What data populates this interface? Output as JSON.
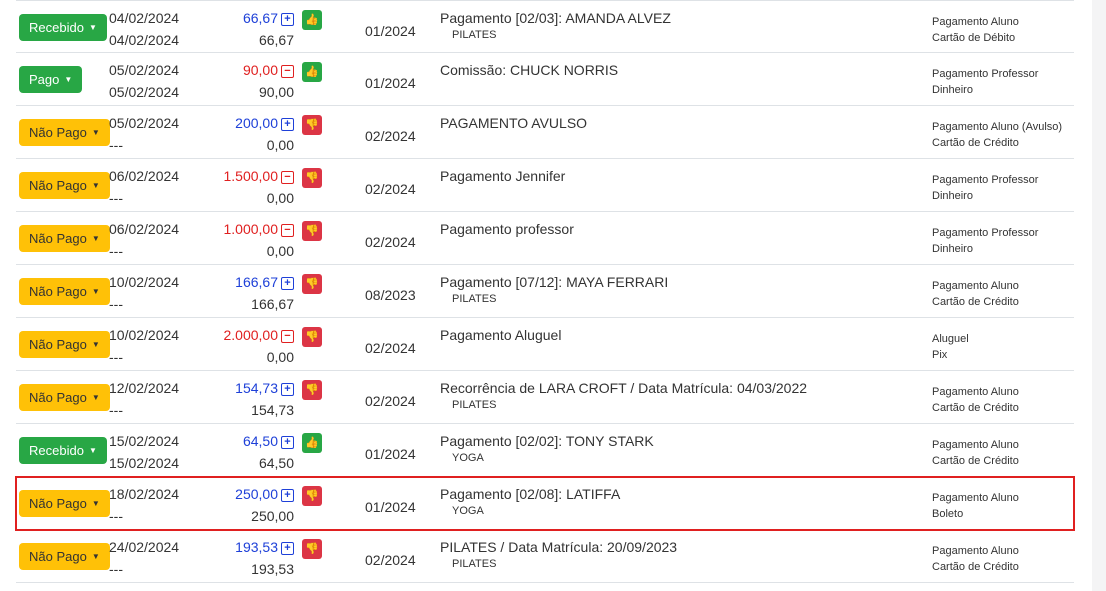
{
  "rows": [
    {
      "status": "Recebido",
      "status_color": "green",
      "date1": "04/02/2024",
      "date2": "04/02/2024",
      "amount": "66,67",
      "amount_color": "blue",
      "sign": "+",
      "paid": "66,67",
      "thumb": "up",
      "period": "01/2024",
      "desc": "Pagamento [02/03]: AMANDA ALVEZ",
      "sub": "PILATES",
      "cat1": "Pagamento Aluno",
      "cat2": "Cartão de Débito"
    },
    {
      "status": "Pago",
      "status_color": "green",
      "date1": "05/02/2024",
      "date2": "05/02/2024",
      "amount": "90,00",
      "amount_color": "red",
      "sign": "−",
      "paid": "90,00",
      "thumb": "up",
      "period": "01/2024",
      "desc": "Comissão: CHUCK NORRIS",
      "sub": "",
      "cat1": "Pagamento Professor",
      "cat2": "Dinheiro"
    },
    {
      "status": "Não Pago",
      "status_color": "yellow",
      "date1": "05/02/2024",
      "date2": "---",
      "amount": "200,00",
      "amount_color": "blue",
      "sign": "+",
      "paid": "0,00",
      "thumb": "down",
      "period": "02/2024",
      "desc": "PAGAMENTO AVULSO",
      "sub": "",
      "cat1": "Pagamento Aluno (Avulso)",
      "cat2": "Cartão de Crédito"
    },
    {
      "status": "Não Pago",
      "status_color": "yellow",
      "date1": "06/02/2024",
      "date2": "---",
      "amount": "1.500,00",
      "amount_color": "red",
      "sign": "−",
      "paid": "0,00",
      "thumb": "down",
      "period": "02/2024",
      "desc": "Pagamento Jennifer",
      "sub": "",
      "cat1": "Pagamento Professor",
      "cat2": "Dinheiro"
    },
    {
      "status": "Não Pago",
      "status_color": "yellow",
      "date1": "06/02/2024",
      "date2": "---",
      "amount": "1.000,00",
      "amount_color": "red",
      "sign": "−",
      "paid": "0,00",
      "thumb": "down",
      "period": "02/2024",
      "desc": "Pagamento professor",
      "sub": "",
      "cat1": "Pagamento Professor",
      "cat2": "Dinheiro"
    },
    {
      "status": "Não Pago",
      "status_color": "yellow",
      "date1": "10/02/2024",
      "date2": "---",
      "amount": "166,67",
      "amount_color": "blue",
      "sign": "+",
      "paid": "166,67",
      "thumb": "down",
      "period": "08/2023",
      "desc": "Pagamento [07/12]: MAYA FERRARI",
      "sub": "PILATES",
      "cat1": "Pagamento Aluno",
      "cat2": "Cartão de Crédito"
    },
    {
      "status": "Não Pago",
      "status_color": "yellow",
      "date1": "10/02/2024",
      "date2": "---",
      "amount": "2.000,00",
      "amount_color": "red",
      "sign": "−",
      "paid": "0,00",
      "thumb": "down",
      "period": "02/2024",
      "desc": "Pagamento Aluguel",
      "sub": "",
      "cat1": "Aluguel",
      "cat2": "Pix"
    },
    {
      "status": "Não Pago",
      "status_color": "yellow",
      "date1": "12/02/2024",
      "date2": "---",
      "amount": "154,73",
      "amount_color": "blue",
      "sign": "+",
      "paid": "154,73",
      "thumb": "down",
      "period": "02/2024",
      "desc": "Recorrência de LARA CROFT / Data Matrícula: 04/03/2022",
      "sub": "PILATES",
      "cat1": "Pagamento Aluno",
      "cat2": "Cartão de Crédito"
    },
    {
      "status": "Recebido",
      "status_color": "green",
      "date1": "15/02/2024",
      "date2": "15/02/2024",
      "amount": "64,50",
      "amount_color": "blue",
      "sign": "+",
      "paid": "64,50",
      "thumb": "up",
      "period": "01/2024",
      "desc": "Pagamento [02/02]: TONY STARK",
      "sub": "YOGA",
      "cat1": "Pagamento Aluno",
      "cat2": "Cartão de Crédito"
    },
    {
      "status": "Não Pago",
      "status_color": "yellow",
      "date1": "18/02/2024",
      "date2": "---",
      "amount": "250,00",
      "amount_color": "blue",
      "sign": "+",
      "paid": "250,00",
      "thumb": "down",
      "period": "01/2024",
      "desc": "Pagamento [02/08]: LATIFFA",
      "sub": "YOGA",
      "cat1": "Pagamento Aluno",
      "cat2": "Boleto",
      "highlight": true
    },
    {
      "status": "Não Pago",
      "status_color": "yellow",
      "date1": "24/02/2024",
      "date2": "---",
      "amount": "193,53",
      "amount_color": "blue",
      "sign": "+",
      "paid": "193,53",
      "thumb": "down",
      "period": "02/2024",
      "desc": "PILATES / Data Matrícula: 20/09/2023",
      "sub": "PILATES",
      "cat1": "Pagamento Aluno",
      "cat2": "Cartão de Crédito"
    }
  ],
  "icons": {
    "up": "thumbs-up-icon",
    "down": "thumbs-down-icon",
    "plus": "plus-square-icon",
    "minus": "minus-square-icon"
  }
}
